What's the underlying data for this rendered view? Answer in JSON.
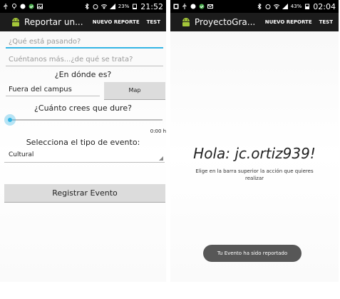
{
  "left": {
    "status": {
      "battery": "23%",
      "time": "21:52"
    },
    "actionbar": {
      "title": "Reportar un...",
      "nuevo_reporte": "NUEVO REPORTE",
      "test": "TEST"
    },
    "form": {
      "que_pasa_placeholder": "¿Qué está pasando?",
      "descripcion_placeholder": "Cuéntanos más...¿de qué se trata?",
      "donde_label": "¿En dónde es?",
      "ubicacion_value": "Fuera del campus",
      "map_button": "Map",
      "duracion_label": "¿Cuánto crees que dure?",
      "duracion_value": "0:00 hr",
      "duracion_fraction": 0,
      "tipo_label": "Selecciona el tipo de evento:",
      "tipo_value": "Cultural",
      "registrar_button": "Registrar Evento"
    }
  },
  "right": {
    "status": {
      "battery": "43%",
      "time": "02:04"
    },
    "actionbar": {
      "title": "ProyectoGra...",
      "nuevo_reporte": "NUEVO REPORTE",
      "test": "TEST"
    },
    "greeting": "Hola: jc.ortiz939!",
    "instruction": "Elige en la barra superior la acción que quieres realizar",
    "toast": "Tu Evento ha sido reportado"
  },
  "colors": {
    "accent": "#33b5e5",
    "android_green": "#a4c639",
    "actionbar": "#1c1c1c",
    "statusbar": "#000000"
  }
}
